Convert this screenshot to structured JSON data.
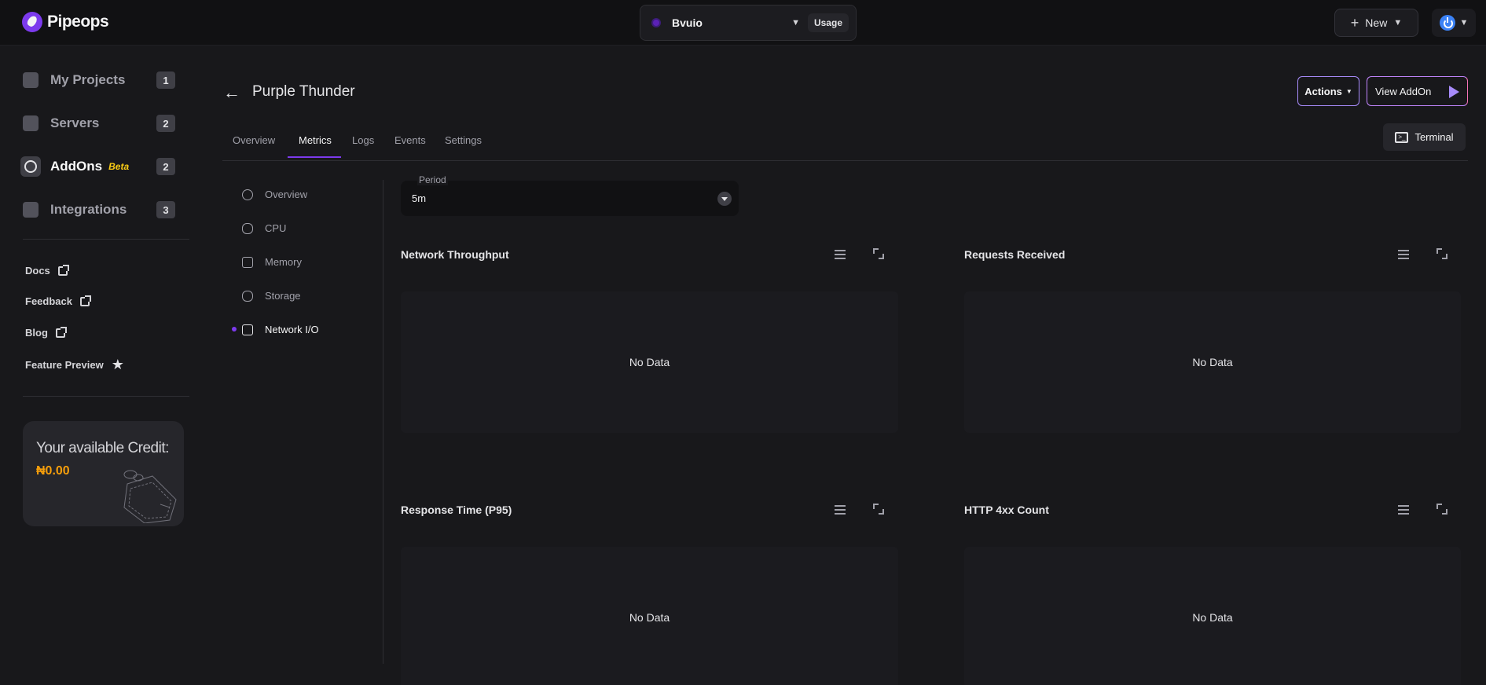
{
  "header": {
    "brand": "Pipeops",
    "project_name": "Bvuio",
    "usage_label": "Usage",
    "new_label": "New"
  },
  "sidebar": {
    "items": [
      {
        "label": "My Projects",
        "count": "1"
      },
      {
        "label": "Servers",
        "count": "2"
      },
      {
        "label": "AddOns",
        "badge": "Beta",
        "count": "2"
      },
      {
        "label": "Integrations",
        "count": "3"
      }
    ],
    "links": [
      "Docs",
      "Feedback",
      "Blog",
      "Feature Preview"
    ],
    "credit": {
      "title": "Your available Credit:",
      "value": "₦0.00"
    }
  },
  "page": {
    "title": "Purple Thunder",
    "actions_label": "Actions",
    "view_addon_label": "View AddOn",
    "terminal_label": "Terminal",
    "tabs": [
      "Overview",
      "Metrics",
      "Logs",
      "Events",
      "Settings"
    ],
    "active_tab": "Metrics"
  },
  "metrics_nav": {
    "items": [
      "Overview",
      "CPU",
      "Memory",
      "Storage",
      "Network I/O"
    ],
    "active": "Network I/O"
  },
  "period": {
    "label": "Period",
    "value": "5m"
  },
  "panels": [
    {
      "title": "Network Throughput",
      "empty_text": "No Data"
    },
    {
      "title": "Requests Received",
      "empty_text": "No Data"
    },
    {
      "title": "Response Time (P95)",
      "empty_text": "No Data"
    },
    {
      "title": "HTTP 4xx Count",
      "empty_text": "No Data"
    }
  ],
  "colors": {
    "accent": "#7c3aed",
    "credit": "#f59e0b",
    "beta": "#facc15"
  }
}
